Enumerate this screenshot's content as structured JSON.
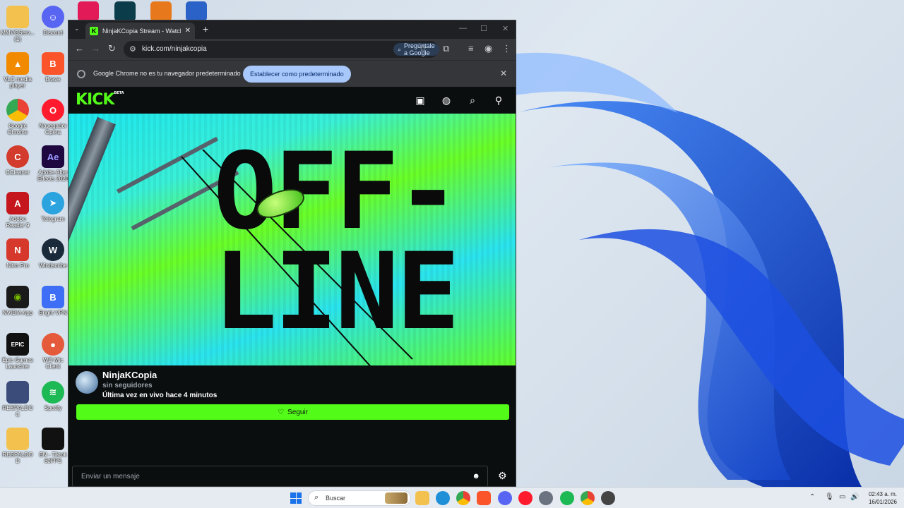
{
  "desktop": {
    "icons_left": [
      {
        "label": "MMVGServ... (1)"
      },
      {
        "label": "VLC media player"
      },
      {
        "label": "Google Chrome"
      },
      {
        "label": "CCleaner"
      },
      {
        "label": "Adobe Reader 9"
      },
      {
        "label": "Nitro Pro"
      },
      {
        "label": "NVIDIA App"
      },
      {
        "label": "Epic Games Launcher"
      },
      {
        "label": "RESPALDO C"
      },
      {
        "label": "RESPALDO D"
      }
    ],
    "icons_right": [
      {
        "label": "Discord"
      },
      {
        "label": "Brave"
      },
      {
        "label": "Navegador Opera"
      },
      {
        "label": "Adobe After Effects 2020"
      },
      {
        "label": "Telegram"
      },
      {
        "label": "Windscribe"
      },
      {
        "label": "Bright VPN"
      },
      {
        "label": "WO Mic Client"
      },
      {
        "label": "Spotify"
      },
      {
        "label": "EN - Tiktok 60FPS"
      }
    ]
  },
  "browser": {
    "tab_title": "NinjaKCopia Stream - Watch Li",
    "url": "kick.com/ninjakcopia",
    "ask_google": "Pregúntale a Google",
    "infobar_message": "Google Chrome no es tu navegador predeterminado",
    "infobar_button": "Establecer como predeterminado"
  },
  "kick": {
    "logo": "KICK",
    "logo_badge": "BETA",
    "banner_text_line1": "OFF-",
    "banner_text_line2": "LINE",
    "channel": {
      "name": "NinjaKCopia",
      "followers": "sin seguidores",
      "last_live": "Última vez en vivo hace 4 minutos",
      "follow_label": "Seguir"
    },
    "chat": {
      "placeholder": "Enviar un mensaje"
    }
  },
  "taskbar": {
    "search_label": "Buscar",
    "time": "02:43 a. m.",
    "date": "16/01/2026"
  },
  "colors": {
    "kick_green": "#53fc18",
    "chrome_surface": "#35363a",
    "infobar_button_bg": "#a8c7fa"
  }
}
